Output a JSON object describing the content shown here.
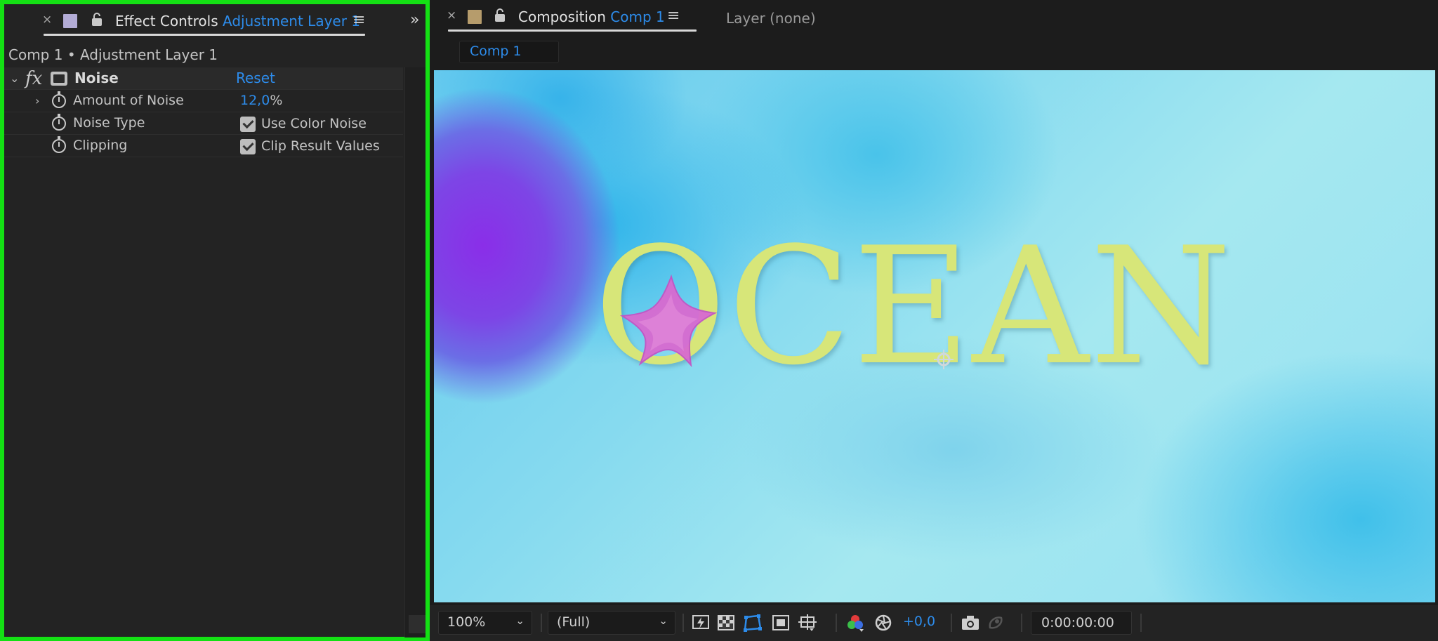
{
  "effect_controls": {
    "tab": {
      "close": "×",
      "prefix": "Effect Controls",
      "layer": "Adjustment Layer 1",
      "menu": "≡",
      "swatch_color": "#b3acd6"
    },
    "expand": "»",
    "layer_path": "Comp 1 • Adjustment Layer 1",
    "effect": {
      "name": "Noise",
      "reset": "Reset"
    },
    "properties": {
      "amount": {
        "label": "Amount of Noise",
        "value": "12,0",
        "unit": "%"
      },
      "noise_type": {
        "label": "Noise Type",
        "checkbox_label": "Use Color Noise",
        "checked": true
      },
      "clipping": {
        "label": "Clipping",
        "checkbox_label": "Clip Result Values",
        "checked": true
      }
    }
  },
  "composition": {
    "tab": {
      "close": "×",
      "prefix": "Composition",
      "comp": "Comp 1",
      "menu": "≡",
      "swatch_color": "#b69c6c"
    },
    "layer_tab": "Layer (none)",
    "subtab": "Comp 1",
    "viewer_text": "OCEAN",
    "footer": {
      "zoom": "100%",
      "resolution": "(Full)",
      "exposure": "+0,0",
      "timecode": "0:00:00:00"
    }
  },
  "colors": {
    "accent": "#2d8ceb",
    "panel_highlight": "#14e014",
    "text_fill": "#d7e679",
    "starfish": "#d86ad0"
  }
}
